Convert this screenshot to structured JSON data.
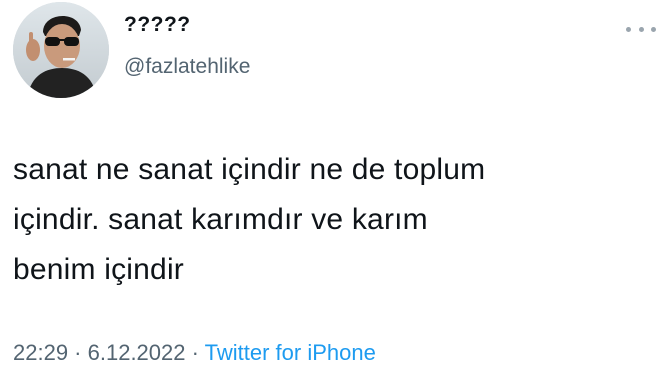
{
  "user": {
    "display_name": "?????",
    "handle": "@fazlatehlike",
    "avatar_icon": "profile-photo"
  },
  "more_icon": "more-dots-icon",
  "tweet": {
    "lines": [
      "sanat ne sanat içindir ne de toplum",
      "içindir. sanat karımdır ve karım",
      "benim içindir"
    ]
  },
  "meta": {
    "time": "22:29",
    "separator1": " · ",
    "date": "6.12.2022",
    "separator2": " · ",
    "source": "Twitter for iPhone"
  },
  "colors": {
    "text": "#0f1419",
    "secondary": "#536471",
    "link": "#1d9bf0"
  }
}
